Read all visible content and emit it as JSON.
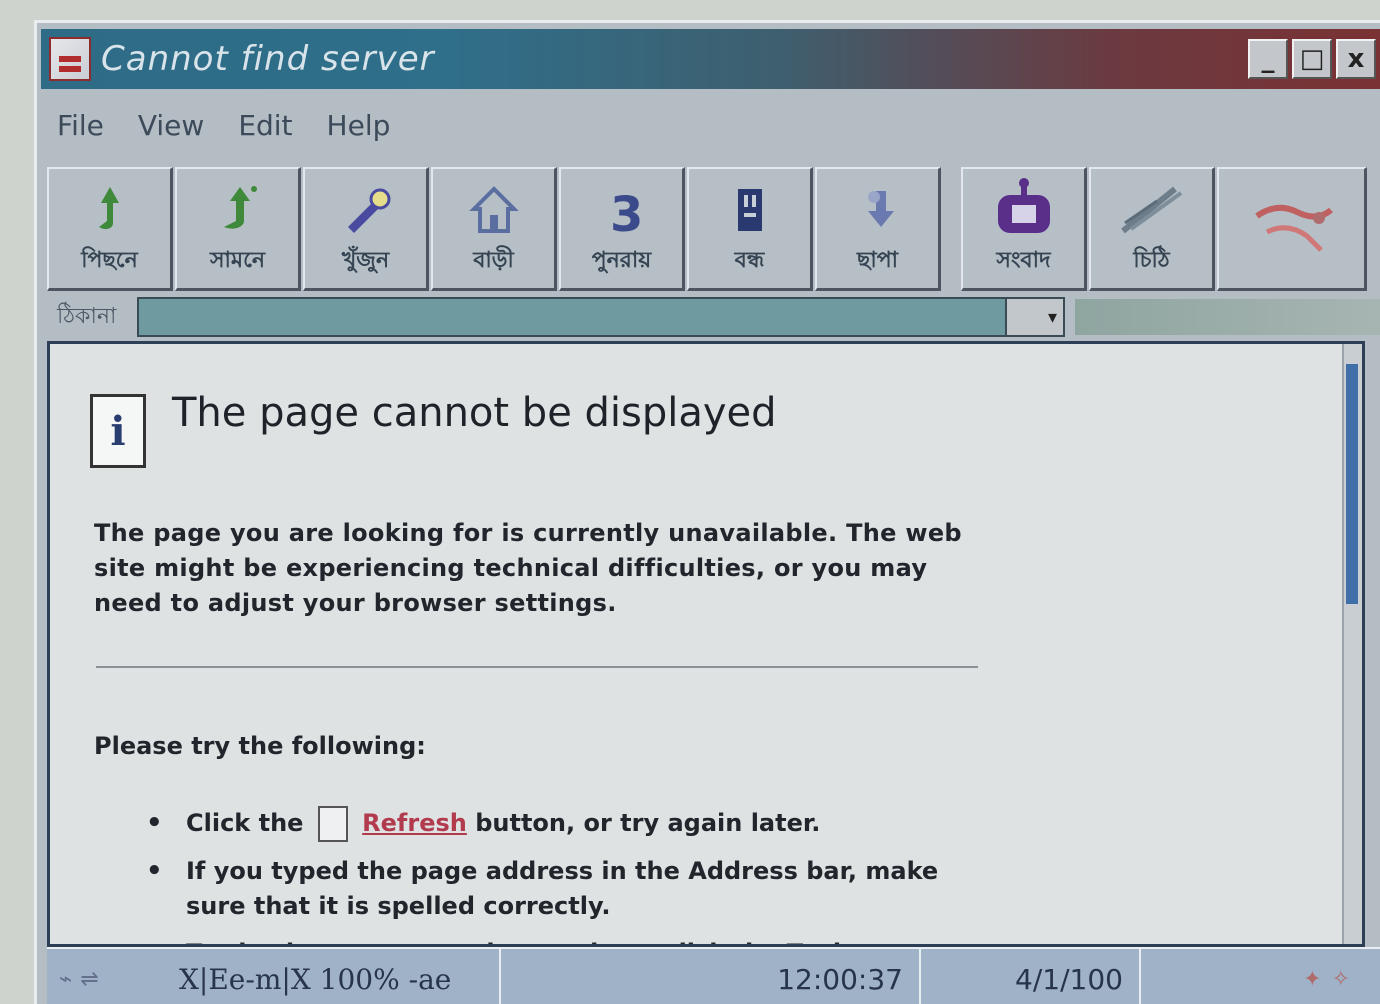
{
  "window": {
    "title": "Cannot find server",
    "controls": {
      "minimize": "_",
      "maximize": "□",
      "close": "x"
    }
  },
  "menu": [
    "File",
    "View",
    "Edit",
    "Help"
  ],
  "toolbar": [
    {
      "label": "পিছনে",
      "icon": "back-icon",
      "color": "#3f8a3a"
    },
    {
      "label": "সামনে",
      "icon": "forward-icon",
      "color": "#3f8a3a"
    },
    {
      "label": "খুঁজুন",
      "icon": "search-icon",
      "color": "#4a4aa0"
    },
    {
      "label": "বাড়ী",
      "icon": "home-icon",
      "color": "#5a6ea0"
    },
    {
      "label": "পুনরায়",
      "icon": "refresh-icon",
      "color": "#3a4a8a"
    },
    {
      "label": "বন্ধ",
      "icon": "stop-icon",
      "color": "#2a3a70"
    },
    {
      "label": "ছাপা",
      "icon": "print-icon",
      "color": "#6a7ab0"
    },
    {
      "label": "সংবাদ",
      "icon": "news-icon",
      "color": "#5a2f8a"
    },
    {
      "label": "চিঠি",
      "icon": "mail-icon",
      "color": "#6d7d8a"
    },
    {
      "label": "",
      "icon": "brand-icon",
      "color": "#c06060"
    }
  ],
  "address": {
    "label": "ঠিকানা",
    "value": ""
  },
  "page": {
    "title": "The page cannot be displayed",
    "description": "The page you are looking for is currently unavailable. The web site might be experiencing technical difficulties, or you may need to adjust your browser settings.",
    "try_label": "Please try the following:",
    "bullet1_prefix": "Click the",
    "bullet1_link": "Refresh",
    "bullet1_suffix": "button, or try again later.",
    "bullet2": "If you typed the page address in the Address bar, make sure that it is spelled correctly.",
    "bullet3": "To check your connection settings, click the Tools menu"
  },
  "status": {
    "text": "X|Ee-m|X 100% -ae",
    "time": "12:00:37",
    "date": "4/1/100"
  },
  "colors": {
    "title_gradient_start": "#2e6b86",
    "title_gradient_end": "#7a3234",
    "link": "#b23a4d"
  }
}
